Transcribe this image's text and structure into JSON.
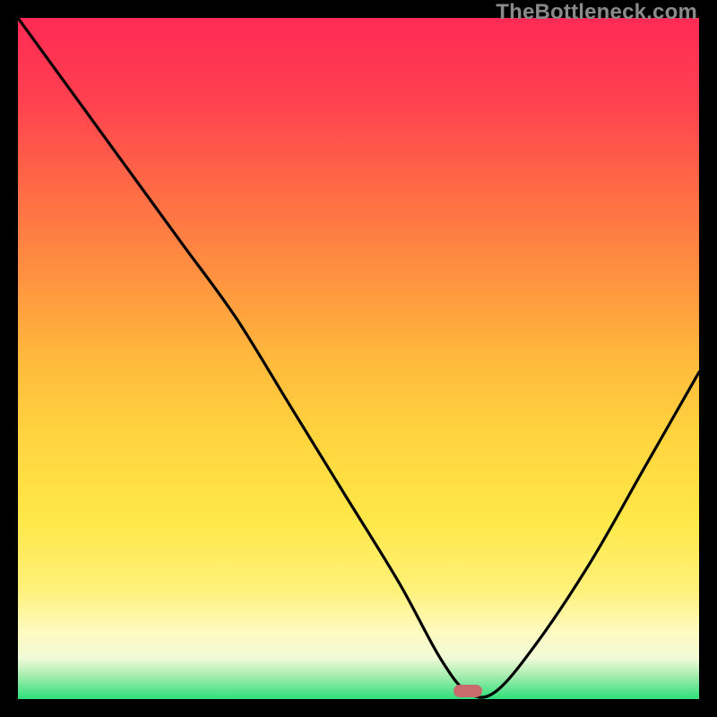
{
  "watermark": "TheBottleneck.com",
  "colors": {
    "top": "#ff2a55",
    "mid1": "#ff8a3c",
    "mid2": "#ffd23c",
    "mid3": "#ffe95a",
    "pale": "#fffbb0",
    "green": "#2ee07a",
    "marker": "#c96a6f",
    "line": "#000000"
  },
  "chart_data": {
    "type": "line",
    "title": "",
    "xlabel": "",
    "ylabel": "",
    "xlim": [
      0,
      100
    ],
    "ylim": [
      0,
      100
    ],
    "annotations": [
      "TheBottleneck.com"
    ],
    "marker": {
      "x": 66,
      "y": 1.2
    },
    "series": [
      {
        "name": "bottleneck-curve",
        "x": [
          0,
          8,
          16,
          24,
          32,
          40,
          48,
          56,
          62,
          66,
          70,
          76,
          84,
          92,
          100
        ],
        "values": [
          100,
          89,
          78,
          67,
          56,
          43,
          30,
          17,
          6,
          1,
          1,
          8,
          20,
          34,
          48
        ]
      }
    ],
    "background_gradient": [
      {
        "stop": 0.0,
        "color": "#ff2a55"
      },
      {
        "stop": 0.25,
        "color": "#ff6a45"
      },
      {
        "stop": 0.5,
        "color": "#ffb93c"
      },
      {
        "stop": 0.7,
        "color": "#ffe34a"
      },
      {
        "stop": 0.86,
        "color": "#fff38f"
      },
      {
        "stop": 0.93,
        "color": "#fffdce"
      },
      {
        "stop": 0.965,
        "color": "#b8f0a0"
      },
      {
        "stop": 1.0,
        "color": "#2ee07a"
      }
    ]
  }
}
